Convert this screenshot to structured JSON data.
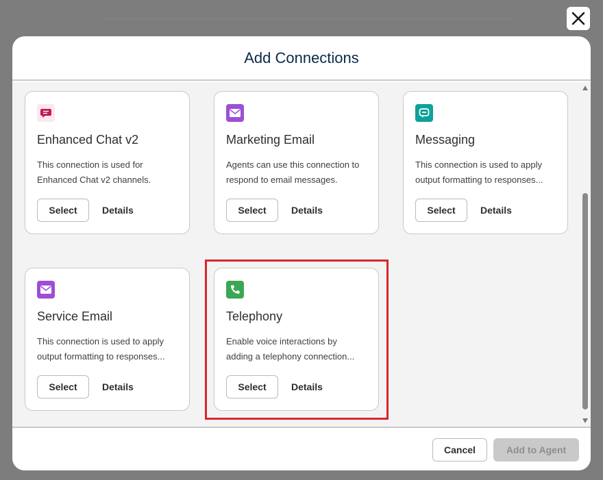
{
  "modal": {
    "title": "Add Connections",
    "close_icon": "close-icon"
  },
  "cards": [
    {
      "title": "Enhanced Chat v2",
      "desc_line1": "This connection is used for",
      "desc_line2": "Enhanced Chat v2 channels.",
      "select_label": "Select",
      "details_label": "Details",
      "icon": "chat-bubble-icon",
      "icon_color": "#c2185b"
    },
    {
      "title": "Marketing Email",
      "desc_line1": "Agents can use this connection to",
      "desc_line2": "respond to email messages.",
      "select_label": "Select",
      "details_label": "Details",
      "icon": "envelope-icon",
      "icon_color": "#9c4fd6"
    },
    {
      "title": "Messaging",
      "desc_line1": "This connection is used to apply",
      "desc_line2": "output formatting to responses...",
      "select_label": "Select",
      "details_label": "Details",
      "icon": "messaging-icon",
      "icon_color": "#0ea29a"
    },
    {
      "title": "Service Email",
      "desc_line1": "This connection is used to apply",
      "desc_line2": "output formatting to responses...",
      "select_label": "Select",
      "details_label": "Details",
      "icon": "envelope-icon",
      "icon_color": "#9c4fd6"
    },
    {
      "title": "Telephony",
      "desc_line1": "Enable voice interactions by",
      "desc_line2": "adding a telephony connection...",
      "select_label": "Select",
      "details_label": "Details",
      "icon": "phone-icon",
      "icon_color": "#3ba755"
    }
  ],
  "footer": {
    "cancel_label": "Cancel",
    "add_label": "Add to Agent"
  },
  "colors": {
    "highlight": "#d9262c",
    "title": "#0a2a4a"
  }
}
